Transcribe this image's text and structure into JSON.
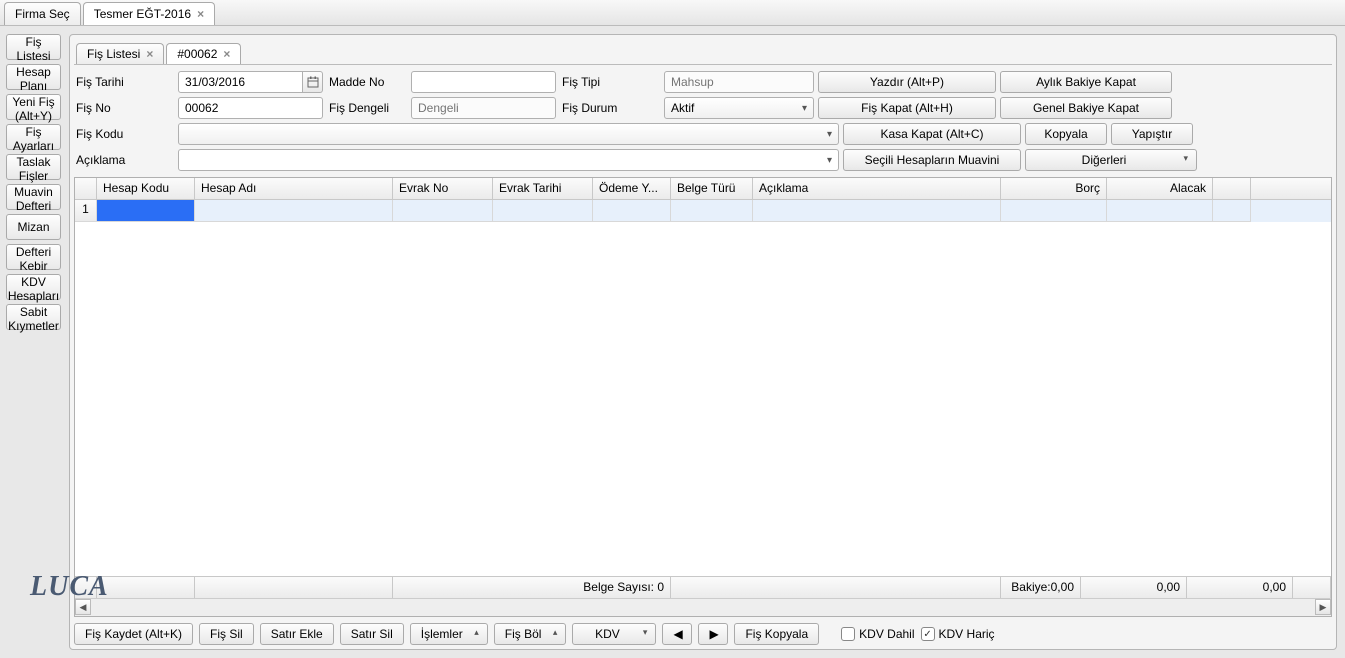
{
  "topTabs": {
    "firma": "Firma Seç",
    "tesmer": "Tesmer EĞT-2016"
  },
  "sidebar": {
    "fisListesi": "Fiş Listesi",
    "hesapPlani": "Hesap Planı Listesi",
    "yeniFis": "Yeni Fiş (Alt+Y)",
    "fisAyarlari": "Fiş Ayarları",
    "taslakFisler": "Taslak Fişler",
    "muavinDefteri": "Muavin Defteri",
    "mizan": "Mizan",
    "defteriKebir": "Defteri Kebir",
    "kdvHesaplari": "KDV Hesapları",
    "sabitKiymetler": "Sabit Kıymetler"
  },
  "innerTabs": {
    "fisListesi": "Fiş Listesi",
    "fis": "#00062"
  },
  "labels": {
    "fisTarihi": "Fiş Tarihi",
    "maddeNo": "Madde No",
    "fisTipi": "Fiş Tipi",
    "fisNo": "Fiş No",
    "fisDengeli": "Fiş Dengeli",
    "fisDurum": "Fiş Durum",
    "fisKodu": "Fiş Kodu",
    "aciklama": "Açıklama"
  },
  "values": {
    "fisTarihi": "31/03/2016",
    "maddeNo": "",
    "fisTipiPh": "Mahsup",
    "fisNo": "00062",
    "fisDengeliPh": "Dengeli",
    "fisDurum": "Aktif",
    "fisKodu": "",
    "aciklama": ""
  },
  "buttons": {
    "yazdir": "Yazdır (Alt+P)",
    "aylikBakiye": "Aylık Bakiye Kapat",
    "fisKapat": "Fiş Kapat (Alt+H)",
    "genelBakiye": "Genel Bakiye Kapat",
    "kasaKapat": "Kasa Kapat (Alt+C)",
    "kopyala": "Kopyala",
    "yapistir": "Yapıştır",
    "seciliMuavin": "Seçili Hesapların Muavini",
    "digerleri": "Diğerleri"
  },
  "grid": {
    "cols": {
      "hesapKodu": "Hesap Kodu",
      "hesapAdi": "Hesap Adı",
      "evrakNo": "Evrak No",
      "evrakTarihi": "Evrak Tarihi",
      "odemeY": "Ödeme Y...",
      "belgeTuru": "Belge Türü",
      "aciklama": "Açıklama",
      "borc": "Borç",
      "alacak": "Alacak"
    },
    "row1": "1",
    "footer": {
      "belgeSayisi": "Belge Sayısı: 0",
      "bakiye": "Bakiye:0,00",
      "borc": "0,00",
      "alacak": "0,00"
    }
  },
  "bottom": {
    "fisKaydet": "Fiş Kaydet (Alt+K)",
    "fisSil": "Fiş Sil",
    "satirEkle": "Satır Ekle",
    "satirSil": "Satır Sil",
    "islemler": "İşlemler",
    "fisBol": "Fiş Böl",
    "kdv": "KDV",
    "fisKopyala": "Fiş Kopyala",
    "kdvDahil": "KDV Dahil",
    "kdvHaric": "KDV Hariç"
  },
  "logo": "LUCA"
}
